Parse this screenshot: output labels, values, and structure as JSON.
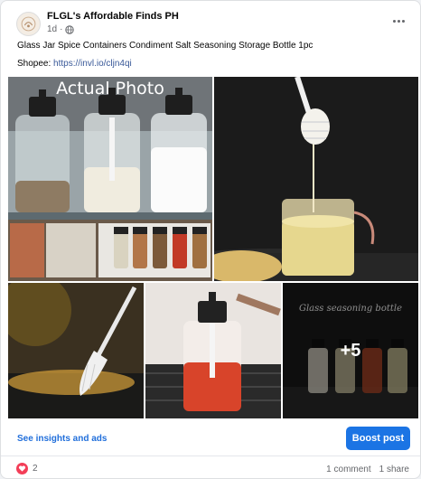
{
  "post": {
    "page_name": "FLGL's Affordable Finds PH",
    "time": "1d",
    "visibility_icon": "globe-icon",
    "more_icon": "more-dots-icon",
    "caption": "Glass Jar Spice Containers Condiment Salt Seasoning Storage Bottle 1pc",
    "shopee_label": "Shopee:",
    "shopee_link": "https://invl.io/cljn4qi"
  },
  "photos": {
    "photo1_overlay": "Actual Photo",
    "photo5_overlay": "Glass seasoning bottle",
    "more_count": "+5"
  },
  "actions": {
    "insights_label": "See insights and ads",
    "boost_label": "Boost post"
  },
  "engagement": {
    "reaction_icon": "heart-icon",
    "reaction_count": "2",
    "comments": "1 comment",
    "shares": "1 share"
  },
  "colors": {
    "link": "#385898",
    "accent": "#1b74e4",
    "heart": "#f33e58"
  }
}
